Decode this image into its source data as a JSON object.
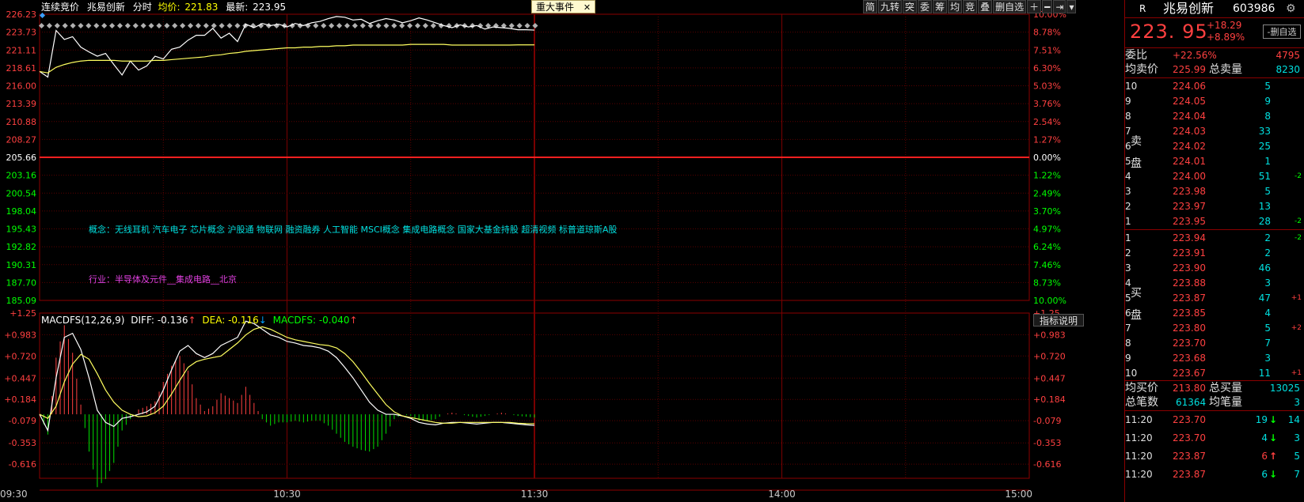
{
  "chart_data": [
    {
      "type": "line",
      "title": "分时",
      "x_ticks": [
        "09:30",
        "10:30",
        "11:30",
        "14:00",
        "15:00"
      ],
      "ylim": [
        185.09,
        226.23
      ],
      "y_ticks": [
        "226.23",
        "223.73",
        "221.11",
        "218.61",
        "216.00",
        "213.39",
        "210.88",
        "208.27",
        "205.66",
        "203.16",
        "200.54",
        "198.04",
        "195.43",
        "192.82",
        "190.31",
        "187.70",
        "185.09"
      ],
      "pct_ticks": [
        "10.00%",
        "8.78%",
        "7.51%",
        "6.30%",
        "5.03%",
        "3.76%",
        "2.54%",
        "1.27%",
        "0.00%",
        "1.22%",
        "2.49%",
        "3.70%",
        "4.97%",
        "6.24%",
        "7.46%",
        "8.73%",
        "10.00%"
      ],
      "prev_close": 205.66,
      "minutes": [
        0,
        2,
        4,
        6,
        8,
        10,
        12,
        14,
        16,
        18,
        20,
        22,
        24,
        26,
        28,
        30,
        32,
        34,
        36,
        38,
        40,
        42,
        44,
        46,
        48,
        50,
        52,
        54,
        56,
        58,
        60,
        62,
        64,
        66,
        68,
        70,
        72,
        74,
        76,
        78,
        80,
        82,
        84,
        86,
        88,
        90,
        92,
        94,
        96,
        98,
        100,
        102,
        104,
        106,
        108,
        110,
        112,
        114,
        116,
        118,
        120
      ],
      "series": [
        {
          "values": [
            218.0,
            217.2,
            223.9,
            222.6,
            223.0,
            221.5,
            220.8,
            220.2,
            220.6,
            219.0,
            217.5,
            219.5,
            218.2,
            218.8,
            220.2,
            219.8,
            221.2,
            221.5,
            222.5,
            223.2,
            223.2,
            224.2,
            222.8,
            223.5,
            222.3,
            224.8,
            224.3,
            224.9,
            224.6,
            224.8,
            224.4,
            224.9,
            224.6,
            225.0,
            225.2,
            225.6,
            225.9,
            225.8,
            225.4,
            225.5,
            224.9,
            225.3,
            225.6,
            225.4,
            225.0,
            225.3,
            225.7,
            225.4,
            225.0,
            224.6,
            224.3,
            224.7,
            224.4,
            224.6,
            224.1,
            224.4,
            224.3,
            224.2,
            224.0,
            224.0,
            223.95
          ]
        },
        {
          "values": [
            218.0,
            217.8,
            218.6,
            219.0,
            219.3,
            219.5,
            219.6,
            219.6,
            219.6,
            219.6,
            219.5,
            219.5,
            219.5,
            219.5,
            219.6,
            219.6,
            219.7,
            219.8,
            219.9,
            220.0,
            220.1,
            220.3,
            220.4,
            220.6,
            220.7,
            220.9,
            221.0,
            221.1,
            221.2,
            221.3,
            221.4,
            221.4,
            221.5,
            221.5,
            221.6,
            221.6,
            221.7,
            221.7,
            221.8,
            221.8,
            221.8,
            221.8,
            221.8,
            221.8,
            221.8,
            221.9,
            221.9,
            221.9,
            221.9,
            221.9,
            221.8,
            221.8,
            221.8,
            221.8,
            221.8,
            221.8,
            221.8,
            221.8,
            221.83,
            221.83,
            221.83
          ]
        }
      ],
      "annotations": {
        "concepts": "概念：无线耳机 汽车电子 芯片概念 沪股通 物联网 融资融券 人工智能 MSCI概念 集成电路概念 国家大基金持股 超清视频 标普道琼斯A股",
        "industry": "行业：半导体及元件__集成电路__北京"
      }
    },
    {
      "type": "bar",
      "title": "MACDFS(12,26,9)",
      "ylim": [
        -0.79,
        1.25
      ],
      "y_ticks": [
        "+1.25",
        "+0.983",
        "+0.720",
        "+0.447",
        "+0.184",
        "-0.079",
        "-0.353",
        "-0.616"
      ],
      "minutes": [
        0,
        2,
        4,
        6,
        8,
        10,
        12,
        14,
        16,
        18,
        20,
        22,
        24,
        26,
        28,
        30,
        32,
        34,
        36,
        38,
        40,
        42,
        44,
        46,
        48,
        50,
        52,
        54,
        56,
        58,
        60,
        62,
        64,
        66,
        68,
        70,
        72,
        74,
        76,
        78,
        80,
        82,
        84,
        86,
        88,
        90,
        92,
        94,
        96,
        98,
        100,
        102,
        104,
        106,
        108,
        110,
        112,
        114,
        116,
        118,
        120
      ],
      "series": [
        {
          "name": "DIFF",
          "values": [
            0.0,
            -0.2,
            0.45,
            0.95,
            1.0,
            0.8,
            0.45,
            0.05,
            -0.1,
            -0.15,
            -0.05,
            -0.03,
            0.0,
            0.03,
            0.1,
            0.3,
            0.55,
            0.78,
            0.85,
            0.75,
            0.7,
            0.75,
            0.85,
            0.9,
            0.95,
            1.15,
            1.12,
            1.05,
            0.98,
            0.95,
            0.9,
            0.88,
            0.85,
            0.84,
            0.82,
            0.78,
            0.7,
            0.58,
            0.45,
            0.3,
            0.15,
            0.05,
            0.0,
            0.0,
            -0.02,
            -0.05,
            -0.1,
            -0.12,
            -0.13,
            -0.11,
            -0.1,
            -0.1,
            -0.11,
            -0.12,
            -0.11,
            -0.1,
            -0.1,
            -0.11,
            -0.12,
            -0.13,
            -0.136
          ]
        },
        {
          "name": "DEA",
          "values": [
            0.0,
            -0.05,
            0.1,
            0.4,
            0.62,
            0.74,
            0.68,
            0.5,
            0.3,
            0.15,
            0.05,
            0.0,
            -0.03,
            -0.02,
            0.02,
            0.1,
            0.25,
            0.42,
            0.58,
            0.65,
            0.68,
            0.7,
            0.72,
            0.8,
            0.88,
            0.98,
            1.05,
            1.08,
            1.05,
            1.0,
            0.95,
            0.92,
            0.9,
            0.88,
            0.86,
            0.85,
            0.82,
            0.75,
            0.65,
            0.52,
            0.38,
            0.25,
            0.12,
            0.03,
            -0.02,
            -0.04,
            -0.06,
            -0.08,
            -0.1,
            -0.11,
            -0.11,
            -0.1,
            -0.1,
            -0.1,
            -0.1,
            -0.1,
            -0.1,
            -0.1,
            -0.11,
            -0.115,
            -0.116
          ]
        },
        {
          "name": "MACDFS",
          "values": [
            0.0,
            -0.25,
            0.7,
            1.1,
            0.76,
            0.12,
            -0.46,
            -0.9,
            -0.8,
            -0.6,
            -0.2,
            -0.06,
            0.06,
            0.1,
            0.16,
            0.4,
            0.6,
            0.72,
            0.54,
            0.2,
            0.04,
            0.1,
            0.26,
            0.2,
            0.14,
            0.34,
            0.14,
            -0.06,
            -0.14,
            -0.1,
            -0.1,
            -0.08,
            -0.1,
            -0.08,
            -0.08,
            -0.14,
            -0.24,
            -0.34,
            -0.4,
            -0.44,
            -0.46,
            -0.4,
            -0.24,
            -0.06,
            0.0,
            -0.02,
            -0.08,
            -0.08,
            -0.06,
            0.0,
            0.02,
            0.0,
            -0.02,
            -0.04,
            -0.02,
            0.0,
            0.02,
            0.0,
            -0.02,
            -0.03,
            -0.04
          ]
        }
      ],
      "last": {
        "diff": "-0.136",
        "dea": "-0.116",
        "macdfs": "-0.040"
      }
    }
  ],
  "header": {
    "mode": "连续竞价",
    "name": "兆易创新",
    "view": "分时",
    "avg_label": "均价:",
    "avg": "221.83",
    "last_label": "最新:",
    "last": "223.95"
  },
  "event_button": {
    "label": "重大事件",
    "close": "✕"
  },
  "toolbar": [
    "简",
    "九转",
    "突",
    "委",
    "筹",
    "均",
    "竞",
    "叠",
    "删自选",
    "＋",
    "━",
    "⇥",
    "▾"
  ],
  "macd_header": {
    "name": "MACDFS(12,26,9)",
    "diff_label": "DIFF:",
    "dea_label": "DEA:",
    "macdfs_label": "MACDFS:",
    "arrow_up": "↑",
    "arrow_down": "↓"
  },
  "indicator_button": "指标说明",
  "quote": {
    "r": "R",
    "name": "兆易创新",
    "code": "603986",
    "gear": "⚙",
    "price": "223. 95",
    "change": "+18.29",
    "change_pct": "+8.89%",
    "delete_btn": "-删自选",
    "weibi_label": "委比",
    "weibi": "+22.56%",
    "weibi_diff": "4795",
    "avg_sell_label": "均卖价",
    "avg_sell": "225.99",
    "total_sell_label": "总卖量",
    "total_sell": "8230",
    "sell_side": [
      "卖",
      "盘"
    ],
    "buy_side": [
      "买",
      "盘"
    ],
    "sells": [
      {
        "lvl": "10",
        "price": "224.06",
        "vol": "5",
        "chg": ""
      },
      {
        "lvl": "9",
        "price": "224.05",
        "vol": "9",
        "chg": ""
      },
      {
        "lvl": "8",
        "price": "224.04",
        "vol": "8",
        "chg": ""
      },
      {
        "lvl": "7",
        "price": "224.03",
        "vol": "33",
        "chg": ""
      },
      {
        "lvl": "6",
        "price": "224.02",
        "vol": "25",
        "chg": ""
      },
      {
        "lvl": "5",
        "price": "224.01",
        "vol": "1",
        "chg": ""
      },
      {
        "lvl": "4",
        "price": "224.00",
        "vol": "51",
        "chg": "-2"
      },
      {
        "lvl": "3",
        "price": "223.98",
        "vol": "5",
        "chg": ""
      },
      {
        "lvl": "2",
        "price": "223.97",
        "vol": "13",
        "chg": ""
      },
      {
        "lvl": "1",
        "price": "223.95",
        "vol": "28",
        "chg": "-2"
      }
    ],
    "buys": [
      {
        "lvl": "1",
        "price": "223.94",
        "vol": "2",
        "chg": "-2"
      },
      {
        "lvl": "2",
        "price": "223.91",
        "vol": "2",
        "chg": ""
      },
      {
        "lvl": "3",
        "price": "223.90",
        "vol": "46",
        "chg": ""
      },
      {
        "lvl": "4",
        "price": "223.88",
        "vol": "3",
        "chg": ""
      },
      {
        "lvl": "5",
        "price": "223.87",
        "vol": "47",
        "chg": "+1"
      },
      {
        "lvl": "6",
        "price": "223.85",
        "vol": "4",
        "chg": ""
      },
      {
        "lvl": "7",
        "price": "223.80",
        "vol": "5",
        "chg": "+2"
      },
      {
        "lvl": "8",
        "price": "223.70",
        "vol": "7",
        "chg": ""
      },
      {
        "lvl": "9",
        "price": "223.68",
        "vol": "3",
        "chg": ""
      },
      {
        "lvl": "10",
        "price": "223.67",
        "vol": "11",
        "chg": "+1"
      }
    ],
    "avg_buy_label": "均买价",
    "avg_buy": "213.80",
    "total_buy_label": "总买量",
    "total_buy": "13025",
    "trades_label": "总笔数",
    "trades": "61364",
    "avg_trade_label": "均笔量",
    "avg_trade": "3",
    "ticks": [
      {
        "time": "11:20",
        "price": "223.70",
        "vol": "19",
        "dir": "↓",
        "count": "14"
      },
      {
        "time": "11:20",
        "price": "223.70",
        "vol": "4",
        "dir": "↓",
        "count": "3"
      },
      {
        "time": "11:20",
        "price": "223.87",
        "vol": "6",
        "dir": "↑",
        "count": "5"
      },
      {
        "time": "11:20",
        "price": "223.87",
        "vol": "6",
        "dir": "↓",
        "count": "7"
      }
    ]
  }
}
